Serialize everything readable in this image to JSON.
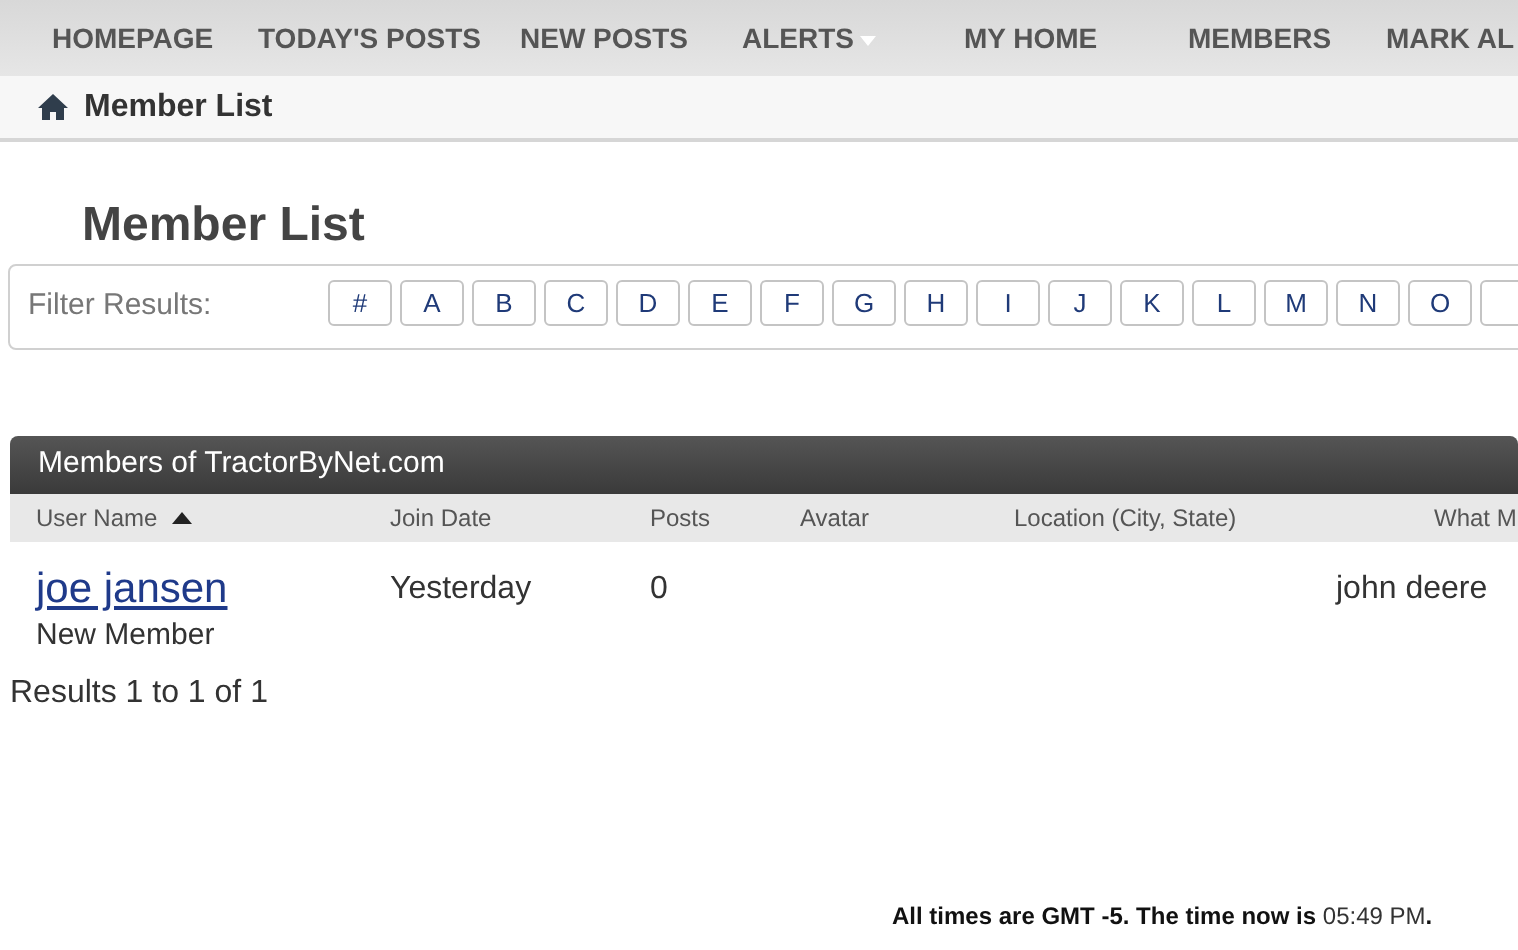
{
  "nav": [
    {
      "label": "HOMEPAGE",
      "dropdown": false
    },
    {
      "label": "TODAY'S POSTS",
      "dropdown": false
    },
    {
      "label": "NEW POSTS",
      "dropdown": false
    },
    {
      "label": "ALERTS",
      "dropdown": true
    },
    {
      "label": "MY HOME",
      "dropdown": false
    },
    {
      "label": "MEMBERS",
      "dropdown": false
    },
    {
      "label": "MARK AL"
    }
  ],
  "breadcrumb": {
    "label": "Member List"
  },
  "page_title": "Member List",
  "filter": {
    "label": "Filter Results:",
    "letters": [
      "#",
      "A",
      "B",
      "C",
      "D",
      "E",
      "F",
      "G",
      "H",
      "I",
      "J",
      "K",
      "L",
      "M",
      "N",
      "O"
    ]
  },
  "table": {
    "title": "Members of TractorByNet.com",
    "columns": [
      {
        "label": "User Name",
        "sorted": true
      },
      {
        "label": "Join Date",
        "sorted": false
      },
      {
        "label": "Posts",
        "sorted": false
      },
      {
        "label": "Avatar",
        "sorted": false
      },
      {
        "label": "Location (City, State)",
        "sorted": false
      },
      {
        "label": "What M"
      }
    ],
    "rows": [
      {
        "username": "joe jansen",
        "rank": "New Member",
        "join_date": "Yesterday",
        "posts": "0",
        "what": "john deere"
      }
    ]
  },
  "results": "Results 1 to 1 of 1",
  "footer": {
    "prefix": "All times are GMT -5. The time now is ",
    "time": "05:49 PM",
    "suffix": "."
  }
}
